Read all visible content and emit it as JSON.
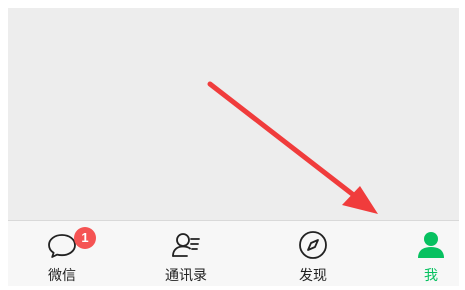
{
  "tabs": [
    {
      "id": "chats",
      "label": "微信",
      "icon": "chat-bubble-icon",
      "badge": "1",
      "active": false
    },
    {
      "id": "contacts",
      "label": "通讯录",
      "icon": "contacts-icon",
      "active": false
    },
    {
      "id": "discover",
      "label": "发现",
      "icon": "compass-icon",
      "active": false
    },
    {
      "id": "me",
      "label": "我",
      "icon": "person-icon",
      "active": true
    }
  ],
  "colors": {
    "accent": "#07c160",
    "badge": "#f55353",
    "arrow": "#f03c3c",
    "background": "#ededed",
    "tabbar": "#f7f7f7"
  }
}
